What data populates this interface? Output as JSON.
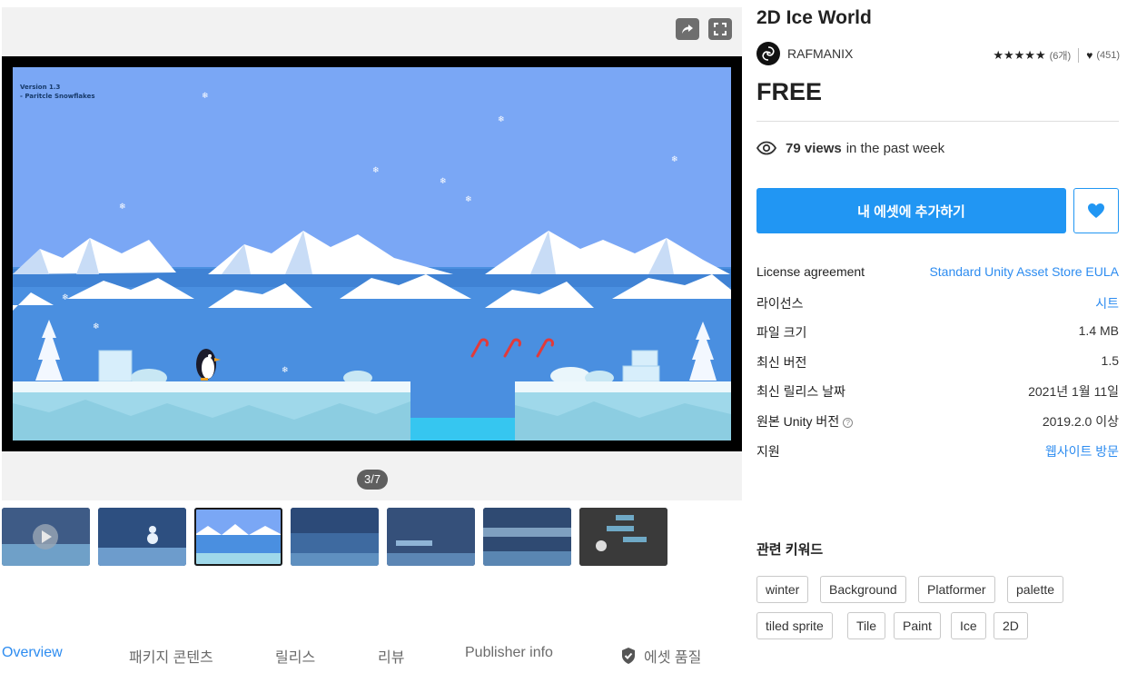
{
  "product": {
    "title": "2D Ice World",
    "publisher": "RAFMANIX",
    "rating_count": "(6개)",
    "favorites_count": "(451)",
    "price": "FREE",
    "views_count": "79 views",
    "views_suffix": "in the past week",
    "add_button": "내 에셋에 추가하기"
  },
  "gallery": {
    "counter": "3/7",
    "screen_text_line1": "Version 1.3",
    "screen_text_line2": "- Paritcle Snowflakes",
    "thumbnail_count": 7
  },
  "details": [
    {
      "key": "License agreement",
      "value": "Standard Unity Asset Store EULA",
      "link": true
    },
    {
      "key": "라이선스",
      "value": "시트",
      "link": true
    },
    {
      "key": "파일 크기",
      "value": "1.4 MB",
      "link": false
    },
    {
      "key": "최신 버전",
      "value": "1.5",
      "link": false
    },
    {
      "key": "최신 릴리스 날짜",
      "value": "2021년 1월 11일",
      "link": false
    },
    {
      "key": "원본 Unity 버전",
      "value": "2019.2.0 이상",
      "link": false,
      "help": "?"
    },
    {
      "key": "지원",
      "value": "웹사이트 방문",
      "link": true
    }
  ],
  "keywords": {
    "title": "관련 키워드",
    "items": [
      "winter",
      "Background",
      "Platformer",
      "palette",
      "tiled sprite",
      "Tile",
      "Paint",
      "Ice",
      "2D"
    ]
  },
  "tabs": [
    "Overview",
    "패키지 콘텐츠",
    "릴리스",
    "리뷰",
    "Publisher info",
    "에셋 품질"
  ],
  "colors": {
    "accent": "#2196f3",
    "link": "#2d8cf0",
    "sky": "#7aa7f5",
    "sea": "#4a8fe0",
    "ice": "#c9ecf5"
  },
  "icons": {
    "share": "share-icon",
    "fullscreen": "fullscreen-icon",
    "eye": "eye-icon",
    "heart": "heart-icon",
    "shield": "shield-check-icon"
  }
}
